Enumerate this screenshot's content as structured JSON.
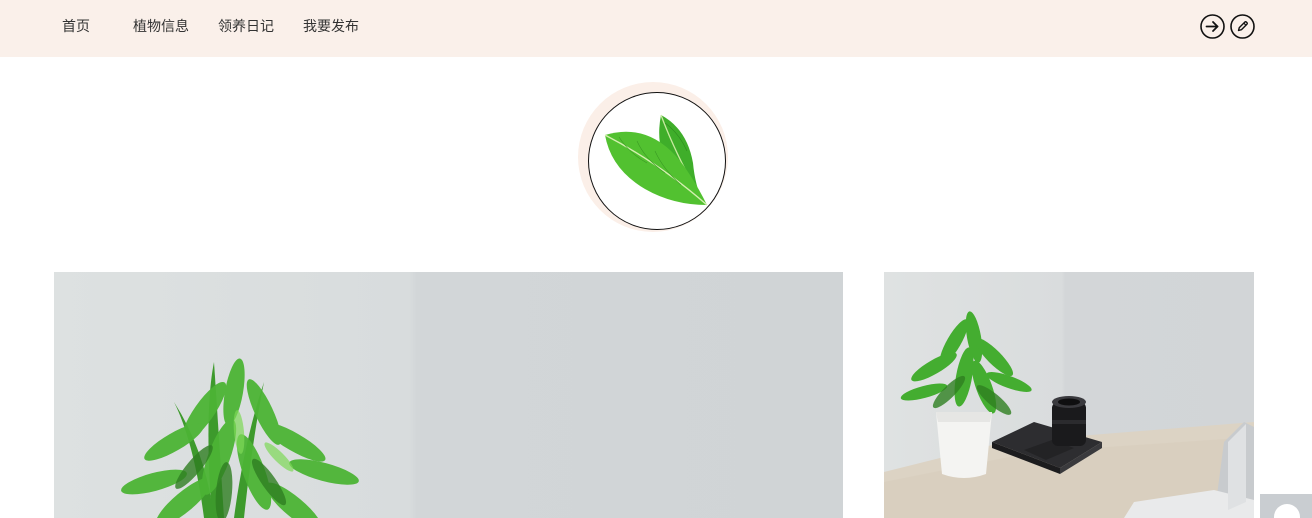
{
  "nav": {
    "items": [
      {
        "label": "首页"
      },
      {
        "label": "植物信息"
      },
      {
        "label": "领养日记"
      },
      {
        "label": "我要发布"
      }
    ],
    "icons": [
      "login-arrow-icon",
      "edit-pencil-icon"
    ]
  },
  "logo": {
    "icon": "leaves-icon"
  },
  "photos": [
    {
      "name": "potted-plant-photo"
    },
    {
      "name": "desk-plant-camera-photo"
    }
  ],
  "colors": {
    "navbar_bg": "#faf0ea",
    "logo_ring_bg": "#fbefe8",
    "leaf_green": "#4caf2a"
  }
}
